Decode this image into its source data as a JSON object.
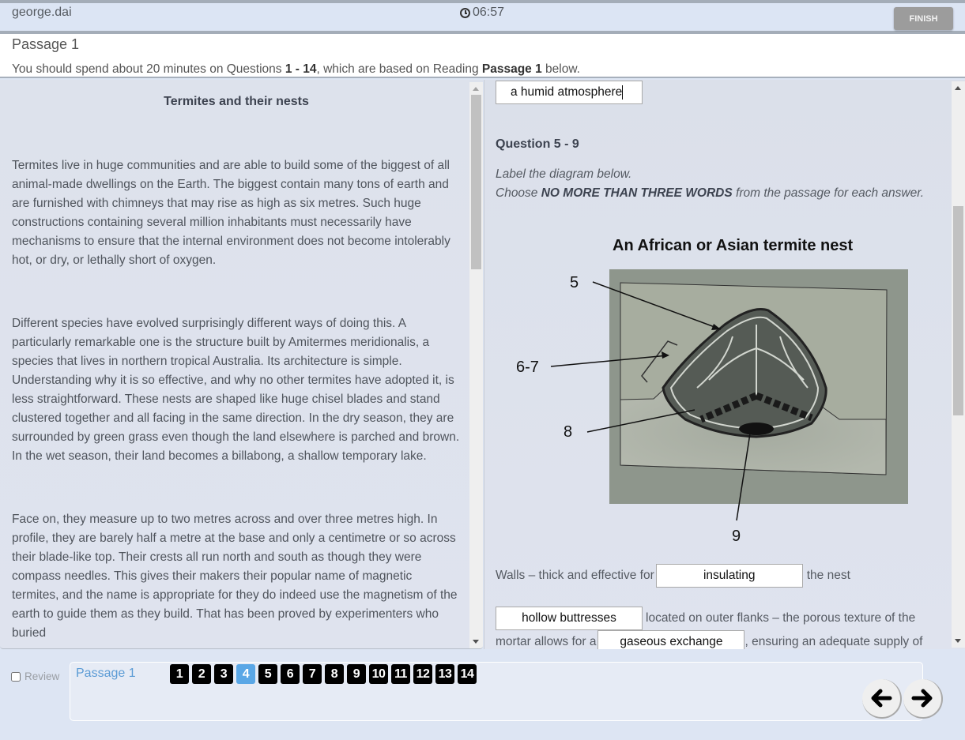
{
  "topbar": {
    "username": "george.dai",
    "timer": "06:57",
    "timer_icon": "clock-icon",
    "finish_label": "FINISH"
  },
  "header": {
    "passage_title": "Passage 1",
    "instructions_pre": "You should spend about 20 minutes on Questions ",
    "instructions_range": "1 - 14",
    "instructions_mid": ", which are based on Reading ",
    "instructions_passage": "Passage 1",
    "instructions_post": " below."
  },
  "passage": {
    "title": "Termites and their nests",
    "paragraphs": [
      "Termites live in huge communities and are able to build some of the biggest of all animal-made dwellings on the Earth. The biggest contain many tons of earth and are furnished with chimneys that may rise as high as six metres. Such huge constructions containing several million inhabitants must necessarily have mechanisms to ensure that the internal environment does not become intolerably hot, or dry, or lethally short of oxygen.",
      "Different species have evolved surprisingly different ways of doing this. A particularly remarkable one is the structure built by Amitermes meridionalis, a species that lives in northern tropical Australia. Its architecture is simple. Understanding why it is so effective, and why no other termites have adopted it, is less straightforward. These nests are shaped like huge chisel blades and stand clustered together and all facing in the same direction. In the dry season, they are surrounded by green grass even though the land elsewhere is parched and brown. In the wet season, their land becomes a billabong, a shallow temporary lake.",
      "Face on, they measure up to two metres across and over three metres high. In profile, they are barely half a metre at the base and only a centimetre or so across their blade-like top. Their crests all run north and south as though they were compass needles. This gives their makers their popular name of magnetic termites, and the name is appropriate for they do indeed use the magnetism of the earth to guide them as they build. That has been proved by experimenters who buried"
    ]
  },
  "questions": {
    "q4_answer": "a humid atmosphere",
    "group_heading": "Question 5 - 9",
    "instruction_line1": "Label the diagram below.",
    "instruction_pre": "Choose ",
    "instruction_bold": "NO MORE THAN THREE WORDS",
    "instruction_post": " from the passage for each answer.",
    "diagram_title": "An African or Asian termite nest",
    "diagram_labels": [
      "5",
      "6-7",
      "8",
      "9"
    ],
    "line1_pre": "Walls – thick and effective for ",
    "q5_answer": "insulating",
    "line1_post": " the nest",
    "q6_answer": "hollow buttresses",
    "line2_post": " located on outer flanks – the porous texture of the",
    "line3_pre": "mortar allows for a ",
    "q7_answer": "gaseous exchange",
    "line3_post": ", ensuring an adequate supply of"
  },
  "footer": {
    "review_label": "Review",
    "review_checked": false,
    "passage_link": "Passage 1",
    "question_numbers": [
      "1",
      "2",
      "3",
      "4",
      "5",
      "6",
      "7",
      "8",
      "9",
      "10",
      "11",
      "12",
      "13",
      "14"
    ],
    "current_question": "4",
    "prev_icon": "arrow-left-icon",
    "next_icon": "arrow-right-icon"
  }
}
